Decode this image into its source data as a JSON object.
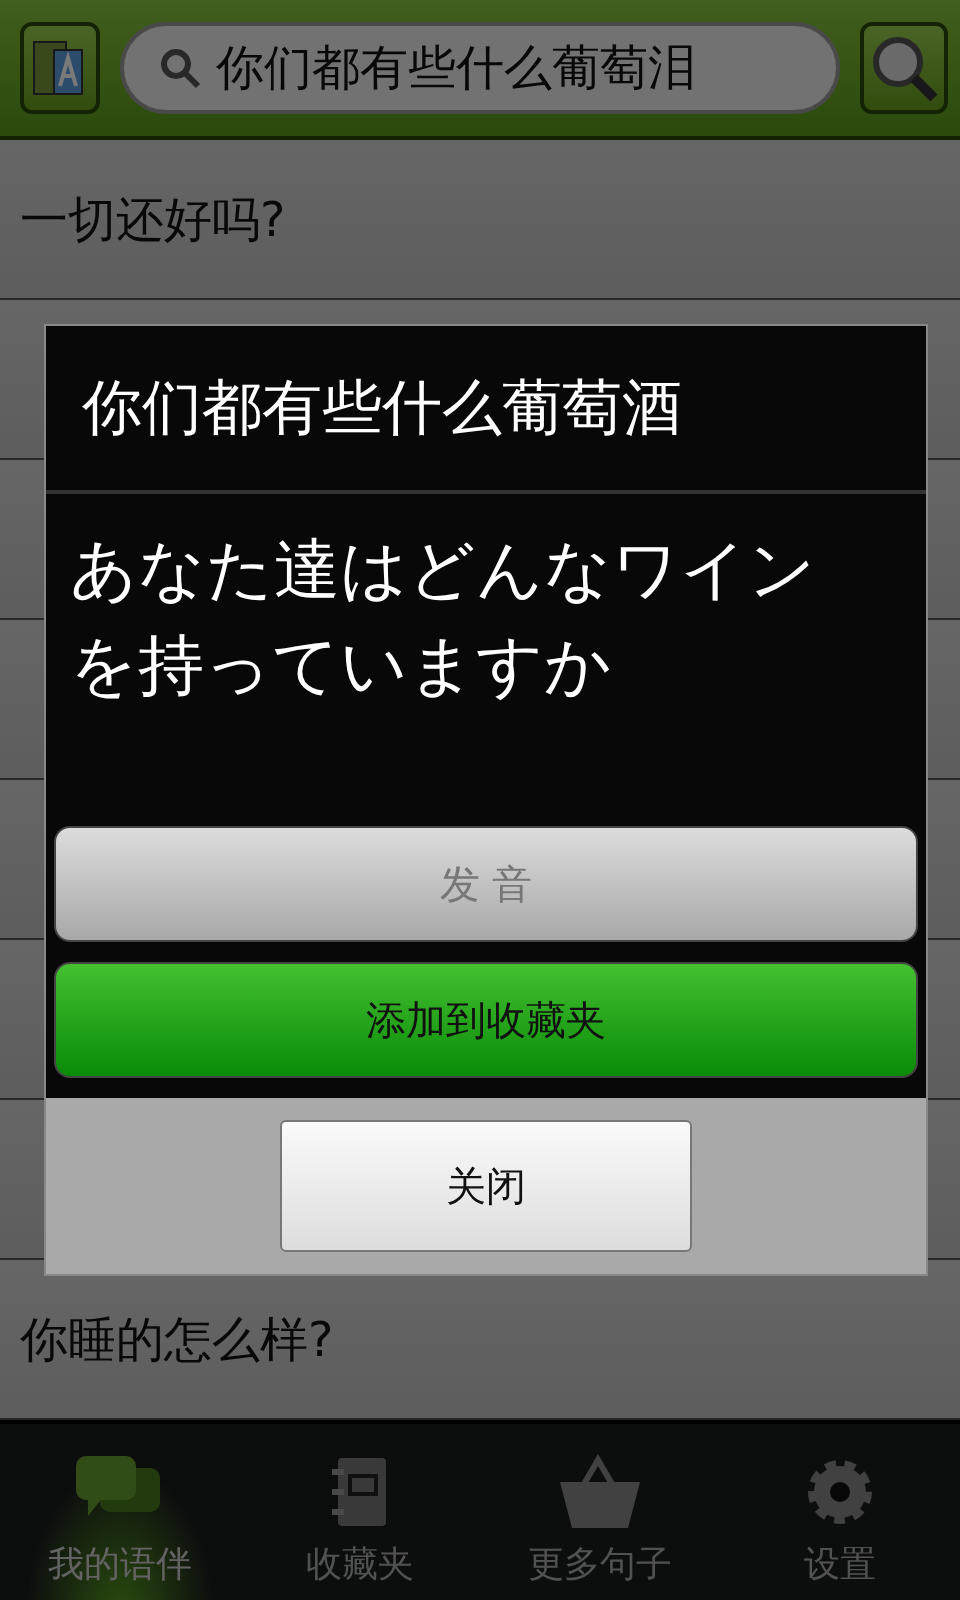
{
  "search": {
    "value": "你们都有些什么葡萄泪"
  },
  "list": [
    {
      "text": "一切还好吗?"
    },
    {
      "text": "你睡的怎么样?"
    }
  ],
  "dialog": {
    "title": "你们都有些什么葡萄酒",
    "message": "あなた達はどんなワインを持っていますか",
    "buttons": [
      {
        "label": "发 音",
        "kind": "muted"
      },
      {
        "label": "添加到收藏夹",
        "kind": "primary"
      }
    ],
    "close": "关闭"
  },
  "tabs": [
    {
      "label": "我的语伴",
      "selected": true
    },
    {
      "label": "收藏夹",
      "selected": false
    },
    {
      "label": "更多句子",
      "selected": false
    },
    {
      "label": "设置",
      "selected": false
    }
  ]
}
